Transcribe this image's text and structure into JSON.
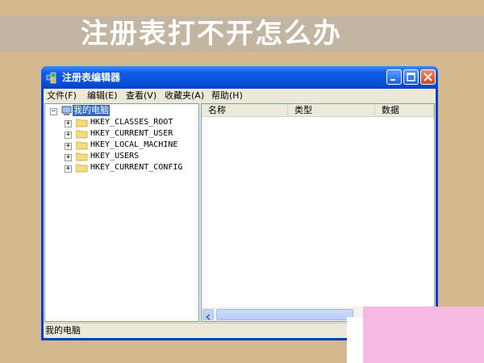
{
  "banner": {
    "title": "注册表打不开怎么办"
  },
  "window": {
    "title": "注册表编辑器",
    "menu": [
      "文件(F)",
      "编辑(E)",
      "查看(V)",
      "收藏夹(A)",
      "帮助(H)"
    ],
    "tree": {
      "root": "我的电脑",
      "nodes": [
        "HKEY_CLASSES_ROOT",
        "HKEY_CURRENT_USER",
        "HKEY_LOCAL_MACHINE",
        "HKEY_USERS",
        "HKEY_CURRENT_CONFIG"
      ]
    },
    "columns": [
      "名称",
      "类型",
      "数据"
    ],
    "status": "我的电脑"
  },
  "colors": {
    "titlebar": "#0a52de",
    "selection": "#316ac5",
    "background": "#d3b98d"
  }
}
